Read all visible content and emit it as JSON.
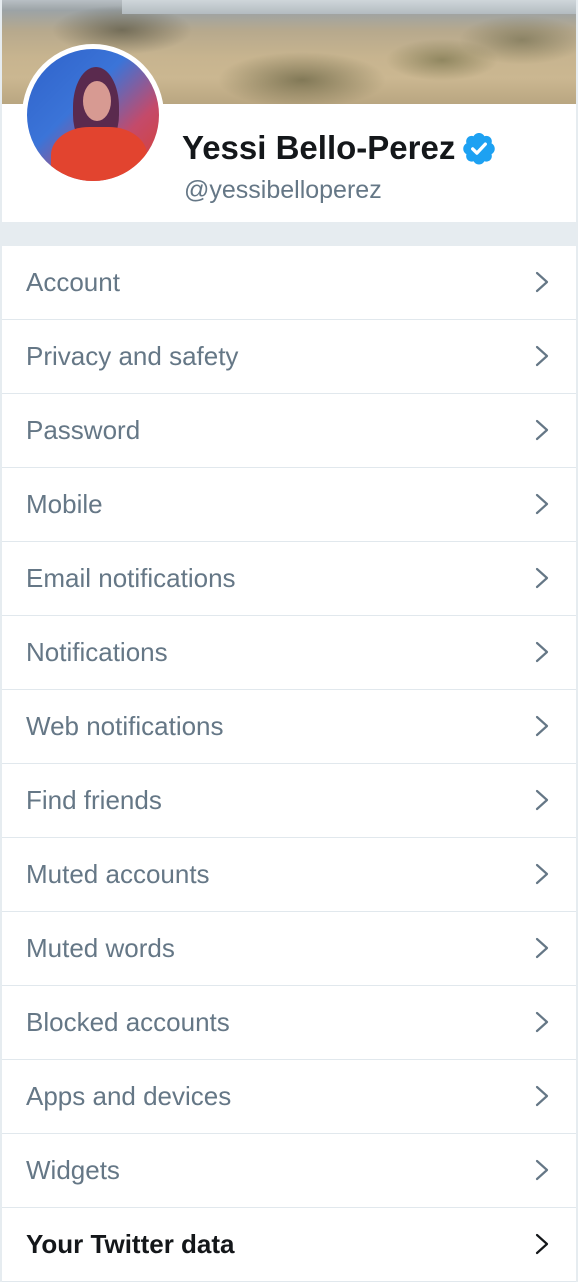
{
  "profile": {
    "display_name": "Yessi Bello-Perez",
    "handle": "@yessibelloperez",
    "verified": true,
    "verified_icon": "verified-badge-icon",
    "accent_color": "#1da1f2"
  },
  "menu": {
    "items": [
      {
        "label": "Account"
      },
      {
        "label": "Privacy and safety"
      },
      {
        "label": "Password"
      },
      {
        "label": "Mobile"
      },
      {
        "label": "Email notifications"
      },
      {
        "label": "Notifications"
      },
      {
        "label": "Web notifications"
      },
      {
        "label": "Find friends"
      },
      {
        "label": "Muted accounts"
      },
      {
        "label": "Muted words"
      },
      {
        "label": "Blocked accounts"
      },
      {
        "label": "Apps and devices"
      },
      {
        "label": "Widgets"
      },
      {
        "label": "Your Twitter data"
      }
    ],
    "chevron_icon": "chevron-right-icon",
    "label_color": "#657786",
    "emphasis_color": "#14171a"
  }
}
